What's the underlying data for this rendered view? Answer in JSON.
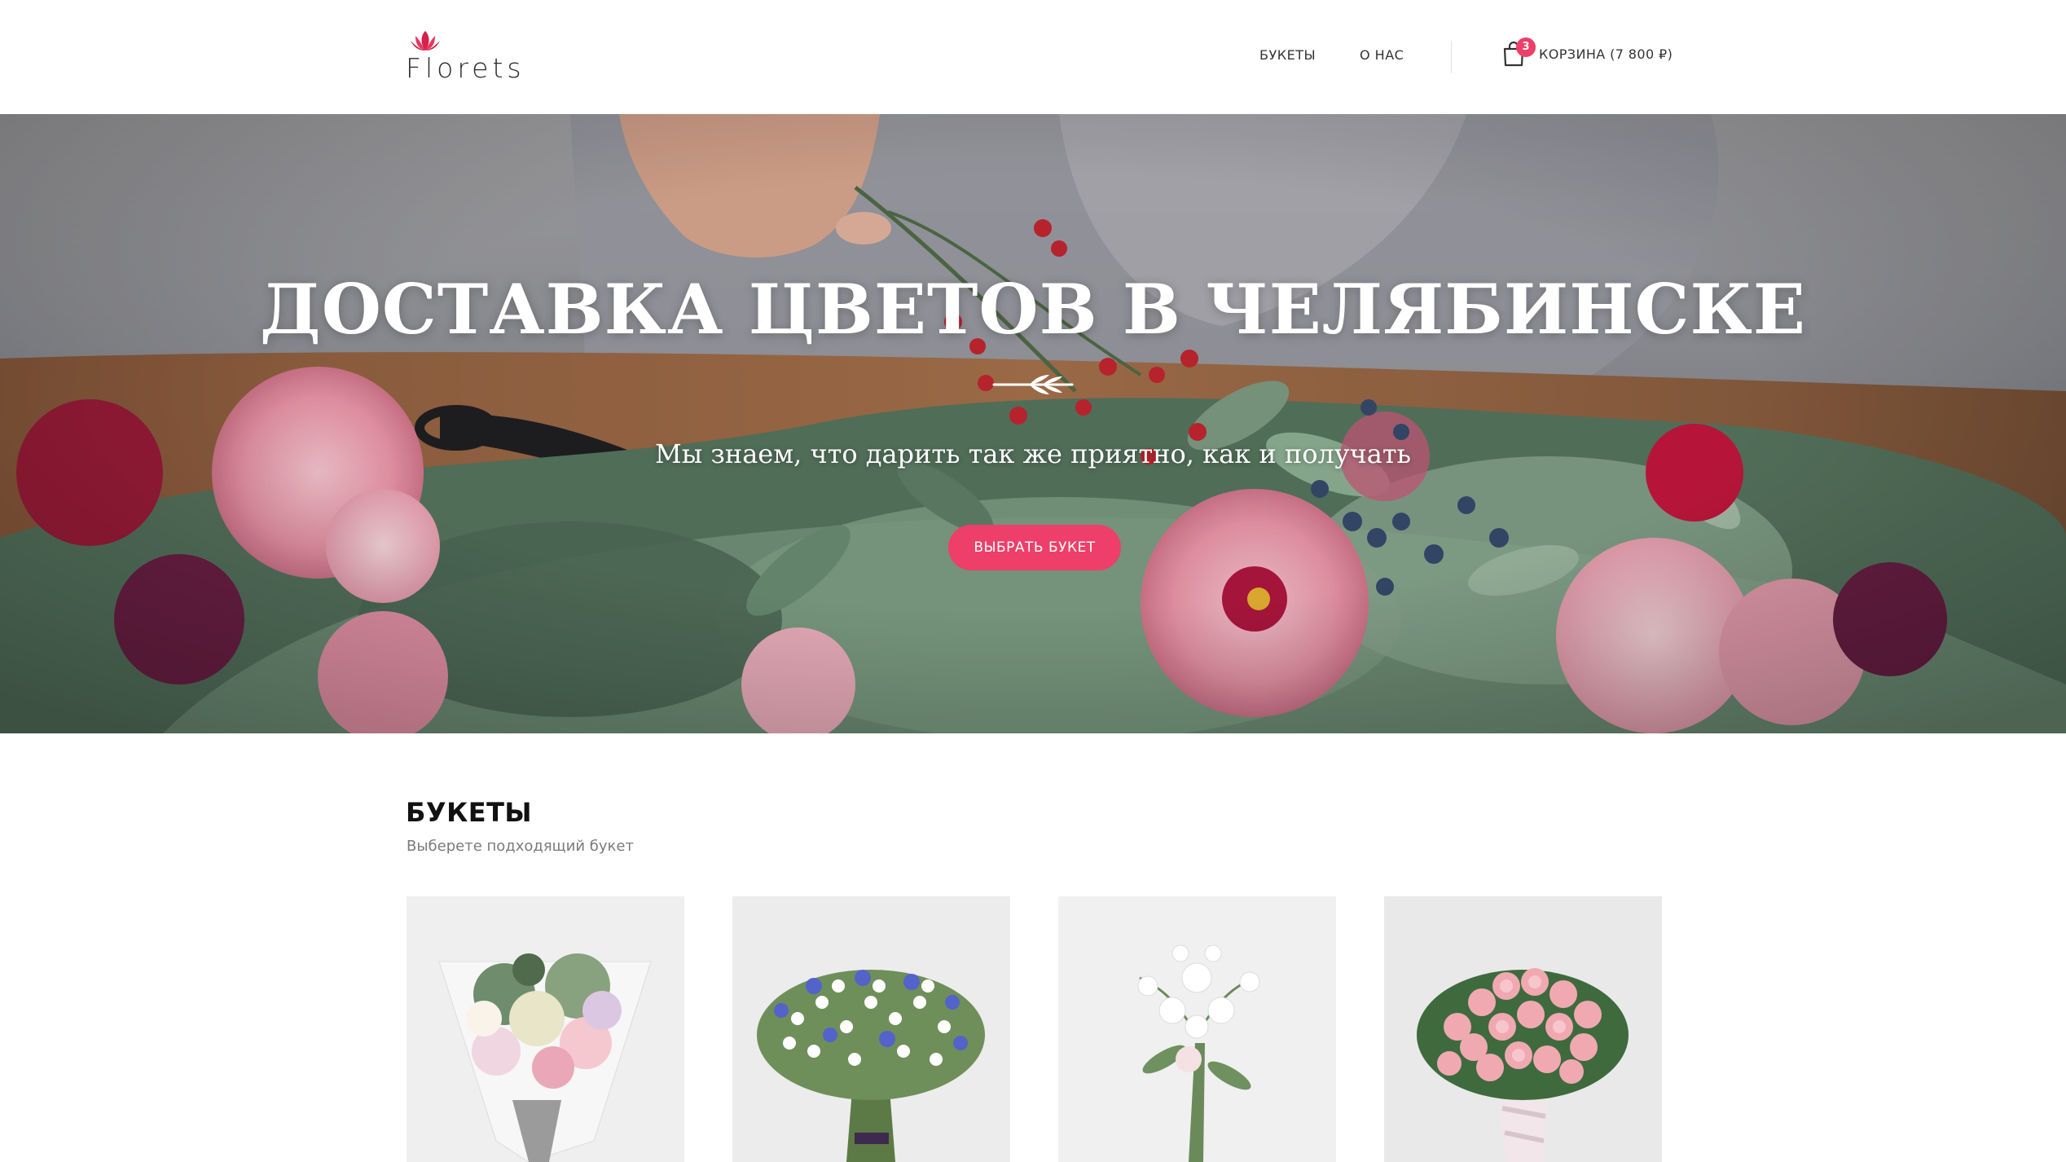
{
  "brand": {
    "name": "Florets",
    "accent": "#ee3e6a"
  },
  "nav": {
    "items": [
      {
        "label": "БУКЕТЫ"
      },
      {
        "label": "О НАС"
      }
    ],
    "cart": {
      "count": "3",
      "label": "КОРЗИНА (7 800 ₽)",
      "icon": "shopping-bag-icon"
    }
  },
  "hero": {
    "title": "ДОСТАВКА ЦВЕТОВ В ЧЕЛЯБИНСКЕ",
    "subtitle": "Мы знаем, что дарить так же приятно, как и получать",
    "button_label": "ВЫБРАТЬ БУКЕТ",
    "ornament_icon": "leaf-branch-icon"
  },
  "bouquets": {
    "title": "БУКЕТЫ",
    "subtitle": "Выберете подходящий букет",
    "items": [
      {
        "image": "mixed-bouquet-in-white-paper"
      },
      {
        "image": "chamomile-cornflower-bouquet"
      },
      {
        "image": "white-flowers-bouquet"
      },
      {
        "image": "pink-roses-bouquet"
      }
    ]
  }
}
